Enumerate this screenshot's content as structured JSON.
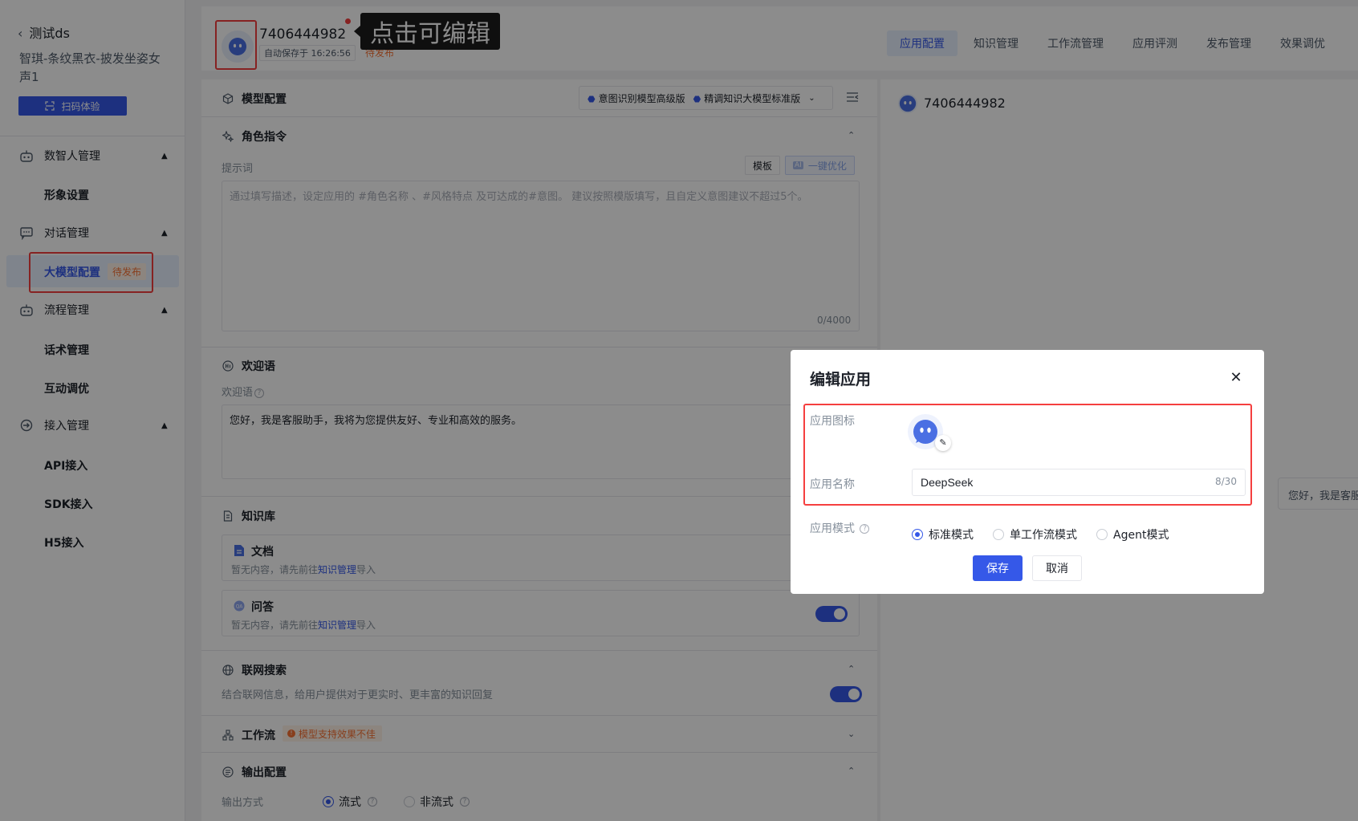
{
  "sidebar": {
    "back_label": "测试ds",
    "app_description": "智琪-条纹黑衣-披发坐姿女声1",
    "scan_button": "扫码体验",
    "groups": [
      {
        "label": "数智人管理",
        "children": [
          "形象设置"
        ]
      },
      {
        "label": "对话管理",
        "children": [
          "大模型配置"
        ]
      },
      {
        "label": "流程管理",
        "children": [
          "话术管理",
          "互动调优"
        ]
      },
      {
        "label": "接入管理",
        "children": [
          "API接入",
          "SDK接入",
          "H5接入"
        ]
      }
    ],
    "active_badge": "待发布"
  },
  "header": {
    "app_title": "7406444982",
    "autosave": "自动保存于 16:26:56",
    "status": "待发布",
    "tooltip": "点击可编辑",
    "tabs": [
      "应用配置",
      "知识管理",
      "工作流管理",
      "应用评测",
      "发布管理",
      "效果调优"
    ],
    "active_tab": "应用配置"
  },
  "config": {
    "model_section": "模型配置",
    "model_chips": [
      "意图识别模型高级版",
      "精调知识大模型标准版"
    ],
    "role_section": "角色指令",
    "prompt_label": "提示词",
    "template_btn": "模板",
    "ai_btn": "一键优化",
    "ai_chip": "AI",
    "prompt_placeholder": "通过填写描述，设定应用的 #角色名称 、#风格特点 及可达成的#意图。 建议按照模版填写，且自定义意图建议不超过5个。",
    "prompt_counter": "0/4000",
    "welcome_section": "欢迎语",
    "welcome_label": "欢迎语",
    "welcome_text": "您好，我是客服助手，我将为您提供友好、专业和高效的服务。",
    "kb_section": "知识库",
    "kb_cards": [
      {
        "title": "文档",
        "desc_prefix": "暂无内容，请先前往",
        "link": "知识管理",
        "desc_suffix": "导入"
      },
      {
        "title": "问答",
        "desc_prefix": "暂无内容，请先前往",
        "link": "知识管理",
        "desc_suffix": "导入"
      }
    ],
    "web_section": "联网搜索",
    "web_desc": "结合联网信息，给用户提供对于更实时、更丰富的知识回复",
    "workflow_section": "工作流",
    "workflow_warn": "模型支持效果不佳",
    "output_section": "输出配置",
    "output_label": "输出方式",
    "output_options": [
      "流式",
      "非流式"
    ],
    "output_selected": "流式"
  },
  "preview": {
    "title": "7406444982",
    "bubble": "您好，我是客服"
  },
  "modal": {
    "title": "编辑应用",
    "icon_label": "应用图标",
    "name_label": "应用名称",
    "name_value": "DeepSeek",
    "name_count": "8/30",
    "mode_label": "应用模式",
    "modes": [
      "标准模式",
      "单工作流模式",
      "Agent模式"
    ],
    "mode_selected": "标准模式",
    "save": "保存",
    "cancel": "取消"
  },
  "colors": {
    "primary": "#3558e8",
    "warning": "#f77234",
    "highlight": "#f53f3f"
  }
}
